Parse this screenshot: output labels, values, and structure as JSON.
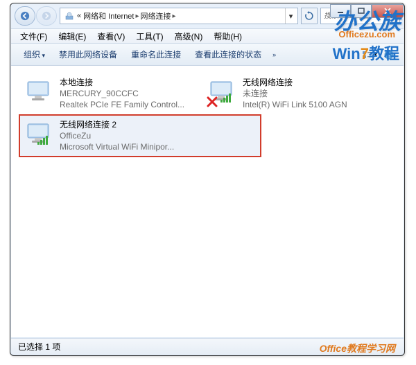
{
  "titlebar": {
    "breadcrumb": {
      "prefix": "«",
      "segment1": "网络和 Internet",
      "segment2": "网络连接"
    },
    "search_placeholder": "搜索 网络连接"
  },
  "menubar": {
    "file": "文件(F)",
    "edit": "编辑(E)",
    "view": "查看(V)",
    "tools": "工具(T)",
    "advanced": "高级(N)",
    "help": "帮助(H)"
  },
  "toolbar": {
    "organize": "组织",
    "disable": "禁用此网络设备",
    "rename": "重命名此连接",
    "status": "查看此连接的状态"
  },
  "connections": [
    {
      "name": "本地连接",
      "network": "MERCURY_90CCFC",
      "device": "Realtek PCIe FE Family Control...",
      "type": "wired",
      "error": false,
      "highlight": false
    },
    {
      "name": "无线网络连接",
      "network": "未连接",
      "device": "Intel(R) WiFi Link 5100 AGN",
      "type": "wireless",
      "error": true,
      "highlight": false
    },
    {
      "name": "无线网络连接 2",
      "network": "OfficeZu",
      "device": "Microsoft Virtual WiFi Minipor...",
      "type": "wireless",
      "error": false,
      "highlight": true
    }
  ],
  "statusbar": {
    "text": "已选择 1 项"
  },
  "watermarks": {
    "brand_cn": "办公族",
    "brand_url": "Officezu.com",
    "tutorial": "Win7教程",
    "footer": "Office教程学习网"
  }
}
